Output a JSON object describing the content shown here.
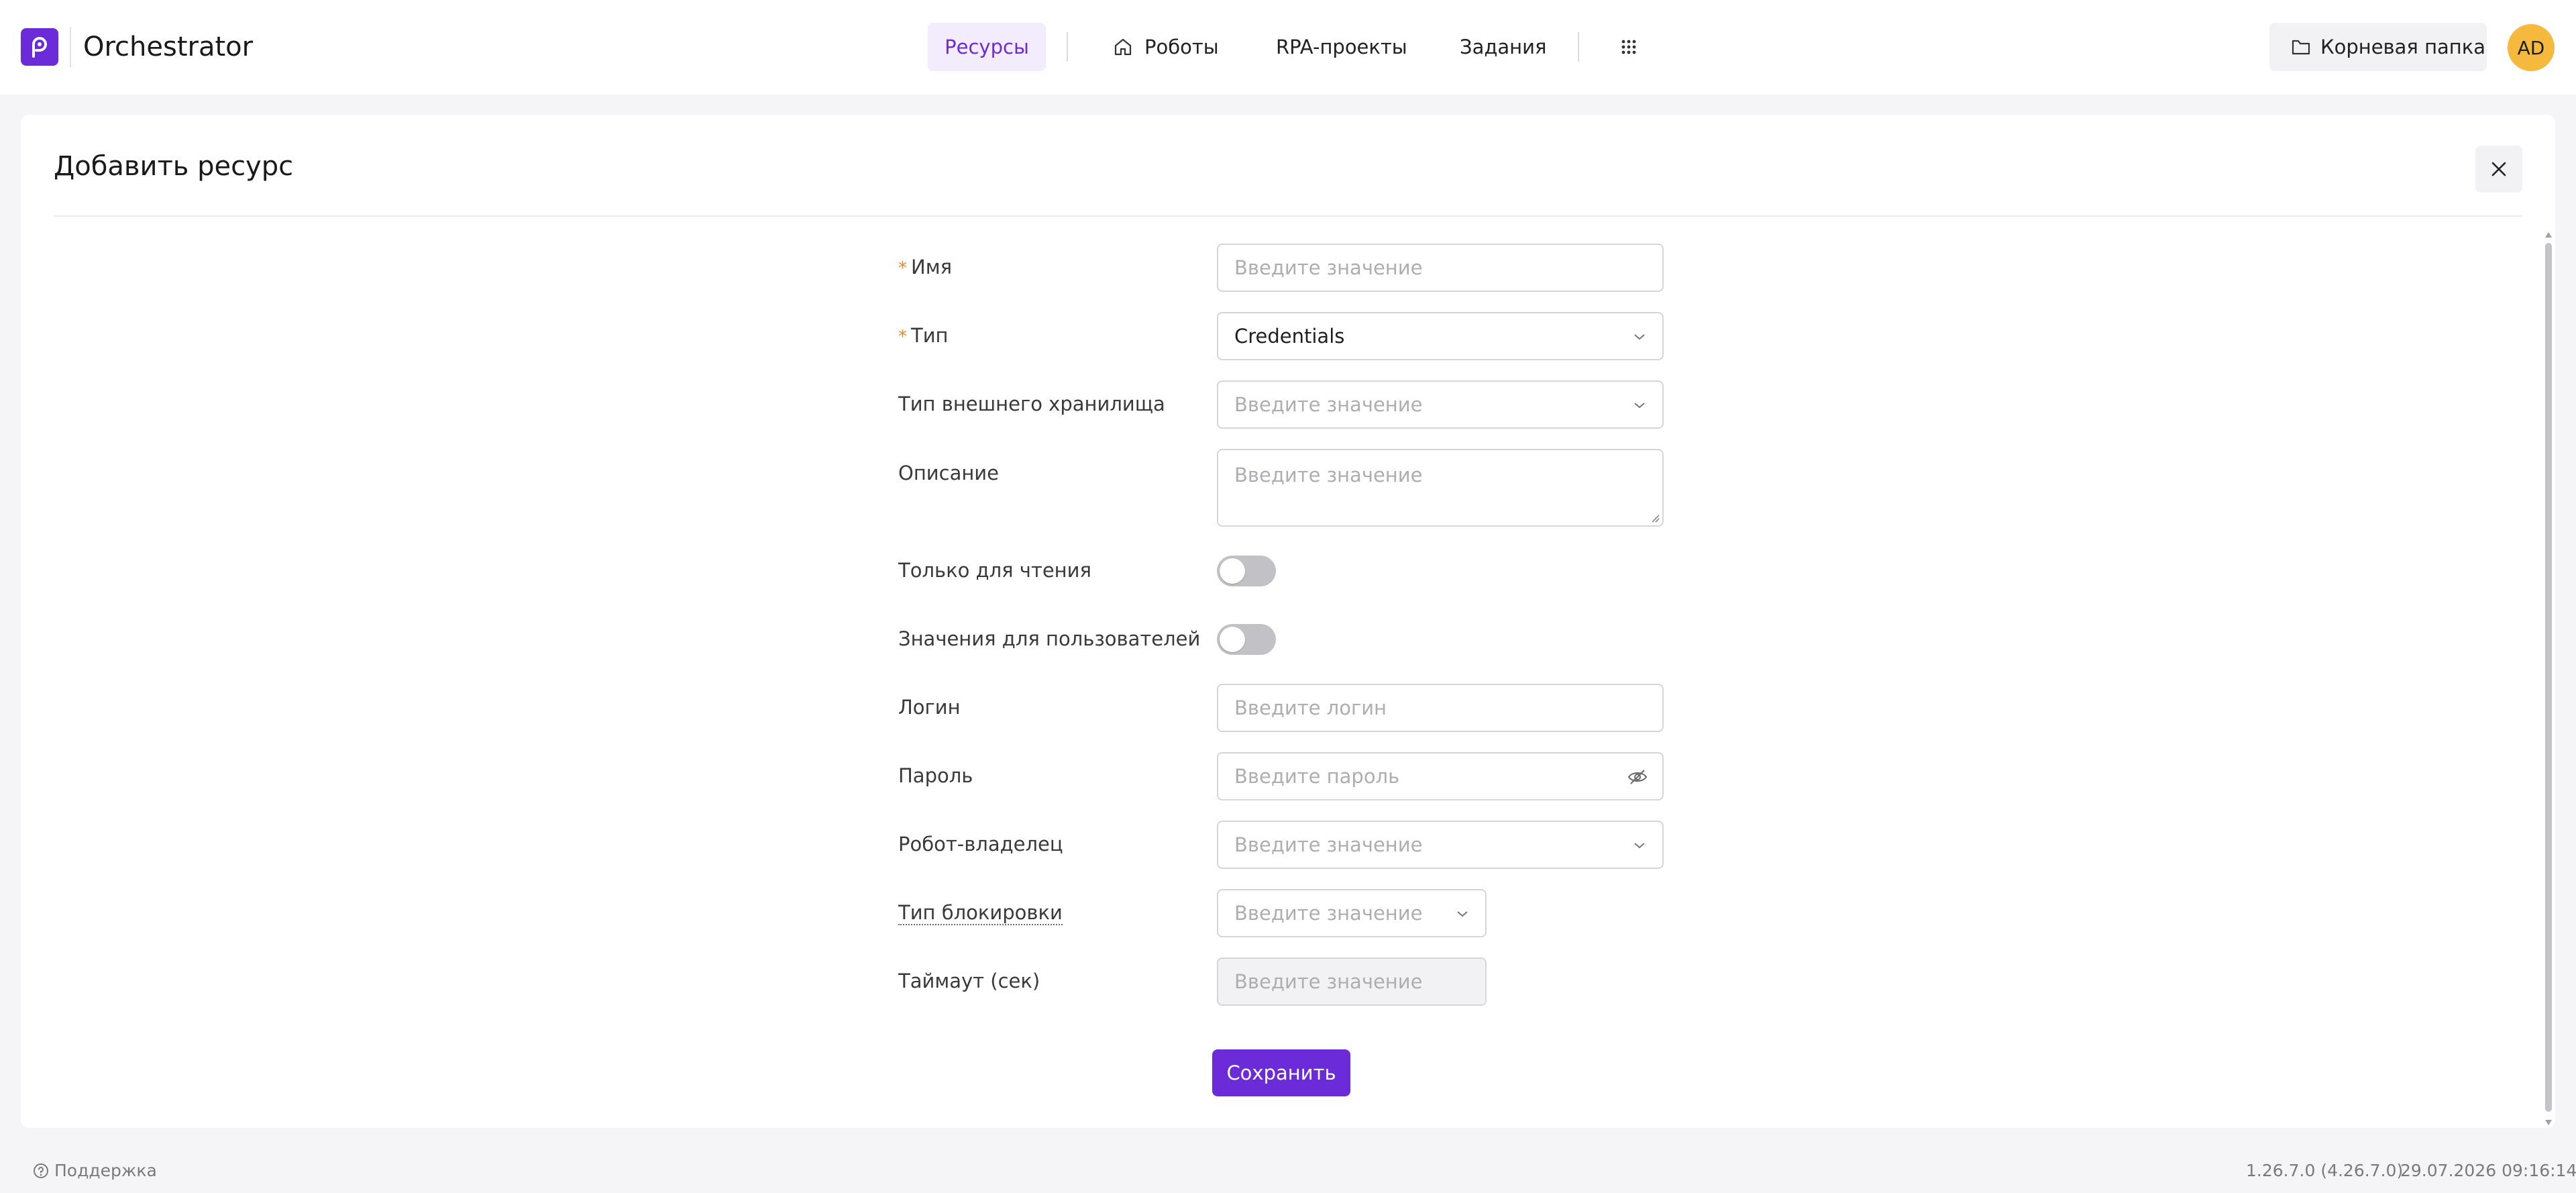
{
  "header": {
    "app_title": "Orchestrator",
    "nav": [
      {
        "label": "Ресурсы",
        "active": true
      },
      {
        "label": "Роботы",
        "icon": "home-icon"
      },
      {
        "label": "RPA-проекты"
      },
      {
        "label": "Задания"
      }
    ],
    "apps_icon": "grid-icon",
    "root_folder": "Корневая папка",
    "avatar": "AD",
    "colors": {
      "accent": "#6c2bd9",
      "avatar": "#f5b93d"
    }
  },
  "dialog": {
    "title": "Добавить ресурс",
    "fields": {
      "name": {
        "label": "Имя",
        "placeholder": "Введите значение",
        "required": true
      },
      "type": {
        "label": "Тип",
        "value": "Credentials",
        "required": true
      },
      "external_storage": {
        "label": "Тип внешнего хранилища",
        "placeholder": "Введите значение"
      },
      "description": {
        "label": "Описание",
        "placeholder": "Введите значение"
      },
      "read_only": {
        "label": "Только для чтения",
        "checked": false
      },
      "user_values": {
        "label": "Значения для пользователей",
        "checked": false
      },
      "login": {
        "label": "Логин",
        "placeholder": "Введите логин"
      },
      "password": {
        "label": "Пароль",
        "placeholder": "Введите пароль"
      },
      "owner_robot": {
        "label": "Робот-владелец",
        "placeholder": "Введите значение"
      },
      "lock_type": {
        "label": "Тип блокировки",
        "placeholder": "Введите значение"
      },
      "timeout": {
        "label": "Таймаут (сек)",
        "placeholder": "Введите значение"
      }
    },
    "save_label": "Сохранить"
  },
  "footer": {
    "support": "Поддержка",
    "version": "1.26.7.0 (4.26.7.0)",
    "datetime": "29.07.2026 09:16:14"
  }
}
